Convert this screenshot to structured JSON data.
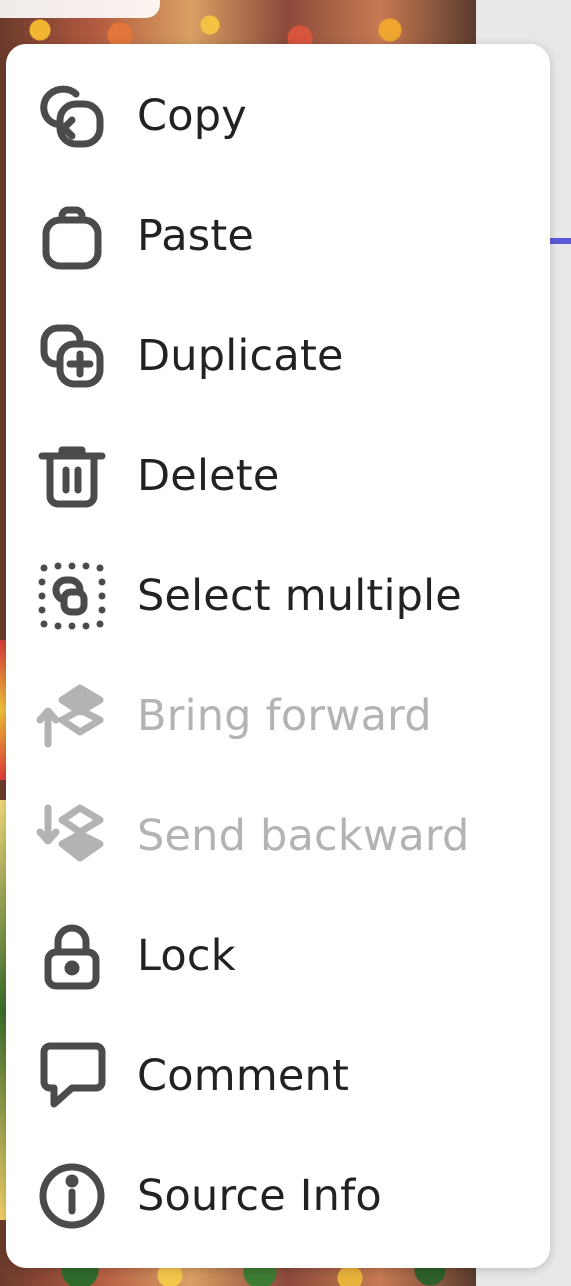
{
  "menu": {
    "items": [
      {
        "id": "copy",
        "label": "Copy",
        "icon": "copy-icon",
        "enabled": true
      },
      {
        "id": "paste",
        "label": "Paste",
        "icon": "paste-icon",
        "enabled": true
      },
      {
        "id": "duplicate",
        "label": "Duplicate",
        "icon": "duplicate-icon",
        "enabled": true
      },
      {
        "id": "delete",
        "label": "Delete",
        "icon": "trash-icon",
        "enabled": true
      },
      {
        "id": "select-multiple",
        "label": "Select multiple",
        "icon": "select-multiple-icon",
        "enabled": true
      },
      {
        "id": "bring-forward",
        "label": "Bring forward",
        "icon": "bring-forward-icon",
        "enabled": false
      },
      {
        "id": "send-backward",
        "label": "Send backward",
        "icon": "send-backward-icon",
        "enabled": false
      },
      {
        "id": "lock",
        "label": "Lock",
        "icon": "lock-icon",
        "enabled": true
      },
      {
        "id": "comment",
        "label": "Comment",
        "icon": "comment-icon",
        "enabled": true
      },
      {
        "id": "source-info",
        "label": "Source Info",
        "icon": "info-icon",
        "enabled": true
      }
    ]
  },
  "colors": {
    "icon": "#4b4b4b",
    "text": "#222222",
    "disabled": "#b3b3b3",
    "accent": "#5a5ad6"
  }
}
